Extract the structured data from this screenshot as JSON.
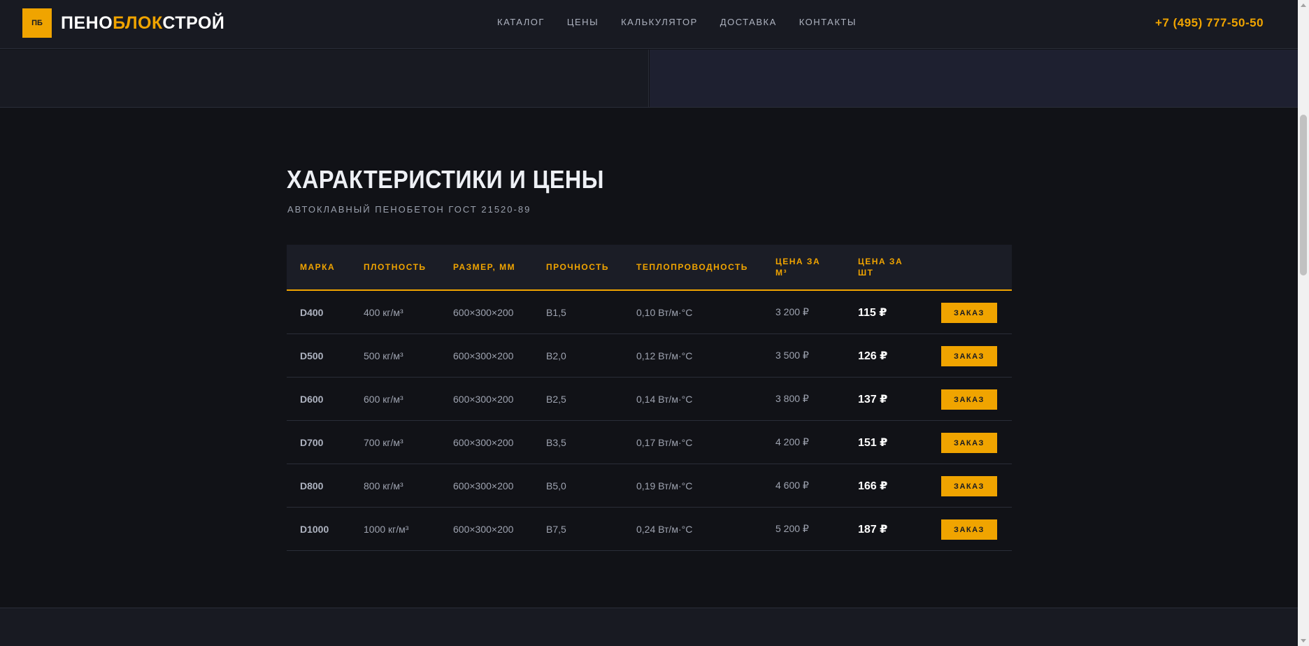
{
  "header": {
    "logo_badge": "ПБ",
    "logo_part1": "ПЕНО",
    "logo_part2": "БЛОК",
    "logo_part3": "СТРОЙ",
    "nav": [
      "КАТАЛОГ",
      "ЦЕНЫ",
      "КАЛЬКУЛЯТОР",
      "ДОСТАВКА",
      "КОНТАКТЫ"
    ],
    "phone": "+7 (495) 777-50-50"
  },
  "section": {
    "title": "ХАРАКТЕРИСТИКИ И ЦЕНЫ",
    "subtitle": "АВТОКЛАВНЫЙ ПЕНОБЕТОН ГОСТ 21520-89"
  },
  "table": {
    "headers": [
      "МАРКА",
      "ПЛОТНОСТЬ",
      "РАЗМЕР, ММ",
      "ПРОЧНОСТЬ",
      "ТЕПЛОПРОВОДНОСТЬ",
      "ЦЕНА ЗА М³",
      "ЦЕНА ЗА ШТ"
    ],
    "order_label": "ЗАКАЗ",
    "rows": [
      {
        "mark": "D400",
        "density": "400 кг/м³",
        "size": "600×300×200",
        "strength": "B1,5",
        "conductivity": "0,10 Вт/м·°С",
        "price_m3": "3 200 ₽",
        "price_pc": "115 ₽"
      },
      {
        "mark": "D500",
        "density": "500 кг/м³",
        "size": "600×300×200",
        "strength": "B2,0",
        "conductivity": "0,12 Вт/м·°С",
        "price_m3": "3 500 ₽",
        "price_pc": "126 ₽"
      },
      {
        "mark": "D600",
        "density": "600 кг/м³",
        "size": "600×300×200",
        "strength": "B2,5",
        "conductivity": "0,14 Вт/м·°С",
        "price_m3": "3 800 ₽",
        "price_pc": "137 ₽"
      },
      {
        "mark": "D700",
        "density": "700 кг/м³",
        "size": "600×300×200",
        "strength": "B3,5",
        "conductivity": "0,17 Вт/м·°С",
        "price_m3": "4 200 ₽",
        "price_pc": "151 ₽"
      },
      {
        "mark": "D800",
        "density": "800 кг/м³",
        "size": "600×300×200",
        "strength": "B5,0",
        "conductivity": "0,19 Вт/м·°С",
        "price_m3": "4 600 ₽",
        "price_pc": "166 ₽"
      },
      {
        "mark": "D1000",
        "density": "1000 кг/м³",
        "size": "600×300×200",
        "strength": "B7,5",
        "conductivity": "0,24 Вт/м·°С",
        "price_m3": "5 200 ₽",
        "price_pc": "187 ₽"
      }
    ]
  },
  "colors": {
    "accent": "#f0a400",
    "background": "#111217",
    "panel": "#181a22"
  }
}
